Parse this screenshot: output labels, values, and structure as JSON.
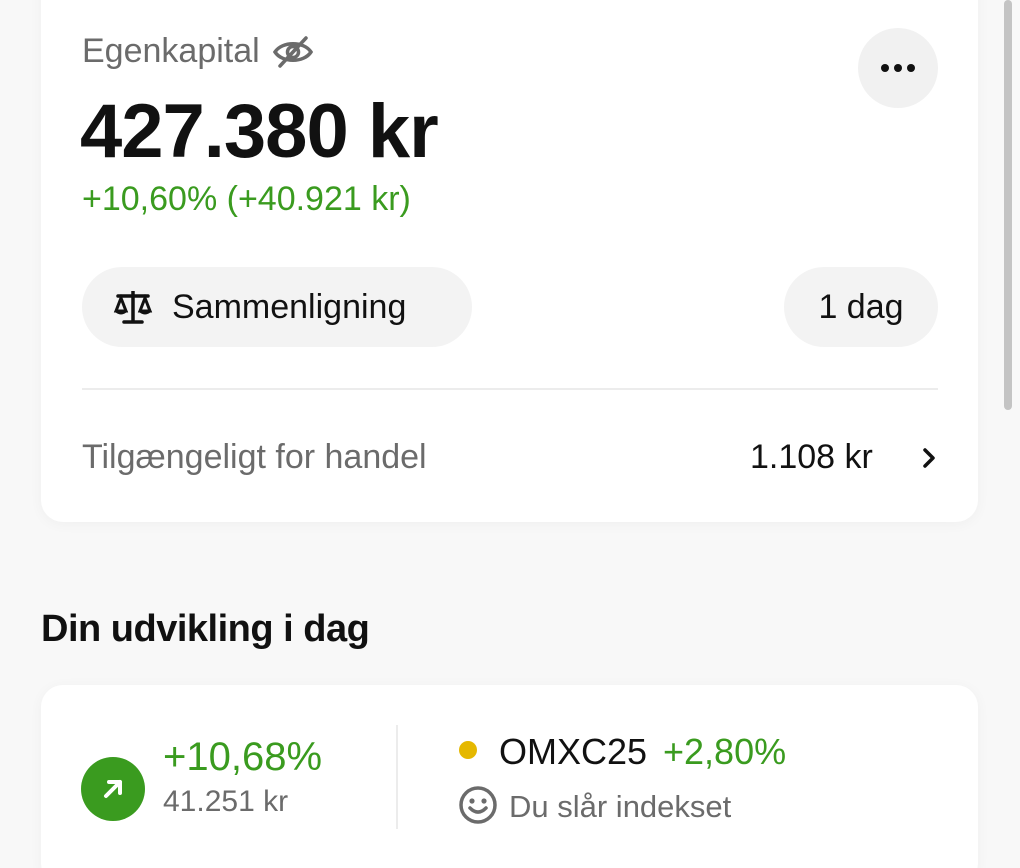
{
  "equity": {
    "label": "Egenkapital",
    "value": "427.380 kr",
    "change": "+10,60% (+40.921 kr)",
    "icons": {
      "visibility": "eye-off-icon",
      "more": "more-horizontal-icon"
    }
  },
  "controls": {
    "compare_label": "Sammenligning",
    "compare_icon": "scale-icon",
    "period_label": "1 dag"
  },
  "available": {
    "label": "Tilgængeligt for handel",
    "value": "1.108 kr"
  },
  "today": {
    "section_title": "Din udvikling i dag",
    "pct": "+10,68%",
    "amount": "41.251 kr",
    "index_name": "OMXC25",
    "index_pct": "+2,80%",
    "beat_text": "Du slår indekset"
  },
  "colors": {
    "positive": "#3a9b1f",
    "index_dot": "#e5b800",
    "muted_text": "#6b6b6b"
  }
}
